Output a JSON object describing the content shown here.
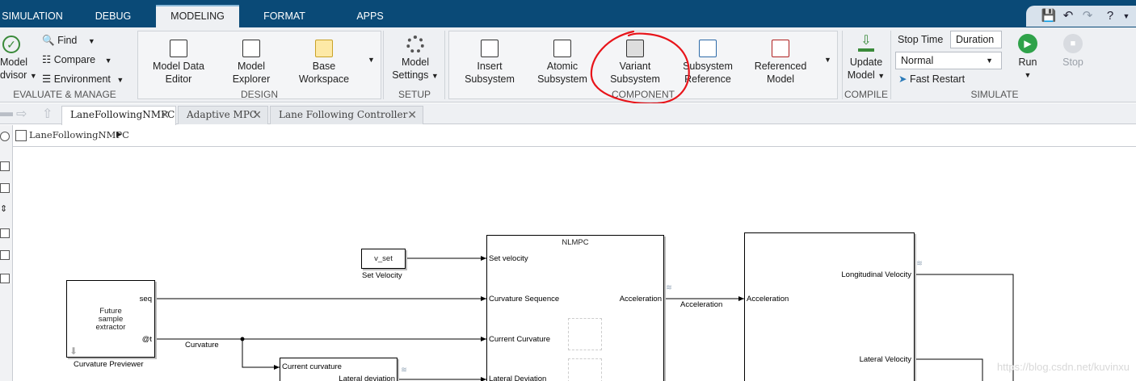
{
  "ribbon_tabs": [
    "SIMULATION",
    "DEBUG",
    "MODELING",
    "FORMAT",
    "APPS"
  ],
  "active_tab": "MODELING",
  "groups": {
    "evaluate": {
      "label": "EVALUATE & MANAGE",
      "model_advisor": [
        "Model",
        "dvisor"
      ],
      "find": "Find",
      "compare": "Compare",
      "environment": "Environment"
    },
    "design": {
      "label": "DESIGN",
      "buttons": [
        [
          "Model Data",
          "Editor"
        ],
        [
          "Model",
          "Explorer"
        ],
        [
          "Base",
          "Workspace"
        ]
      ]
    },
    "setup": {
      "label": "SETUP",
      "button": [
        "Model",
        "Settings"
      ]
    },
    "component": {
      "label": "COMPONENT",
      "buttons": [
        [
          "Insert",
          "Subsystem"
        ],
        [
          "Atomic",
          "Subsystem"
        ],
        [
          "Variant",
          "Subsystem"
        ],
        [
          "Subsystem",
          "Reference"
        ],
        [
          "Referenced",
          "Model"
        ]
      ]
    },
    "compile": {
      "label": "COMPILE",
      "button": [
        "Update",
        "Model"
      ]
    },
    "simulate": {
      "label": "SIMULATE",
      "stop_time_label": "Stop Time",
      "stop_time_value": "Duration",
      "mode": "Normal",
      "fast_restart": "Fast Restart",
      "run": "Run",
      "stop": "Stop"
    }
  },
  "doc_tabs": [
    "LaneFollowingNMPC",
    "Adaptive MPC",
    "Lane Following Controller"
  ],
  "breadcrumb": "LaneFollowingNMPC",
  "canvas": {
    "vset": {
      "text": "v_set",
      "caption": "Set Velocity"
    },
    "nlmpc": {
      "title": "NLMPC",
      "inputs": [
        "Set velocity",
        "Curvature Sequence",
        "Current Curvature",
        "Lateral Deviation"
      ],
      "output": "Acceleration"
    },
    "previewer": {
      "text": [
        "Future",
        "sample",
        "extractor"
      ],
      "caption": "Curvature Previewer",
      "ports": [
        "seq",
        "@t"
      ]
    },
    "curvature_signal": "Curvature",
    "acceleration_signal": "Acceleration",
    "lateral_block": {
      "input": "Current curvature",
      "output": "Lateral deviation"
    },
    "vehicle": {
      "input": "Acceleration",
      "outputs": [
        "Longitudinal Velocity",
        "Lateral Velocity"
      ]
    }
  },
  "watermark": "https://blog.csdn.net/kuvinxu",
  "annotation_color": "#e8141a"
}
